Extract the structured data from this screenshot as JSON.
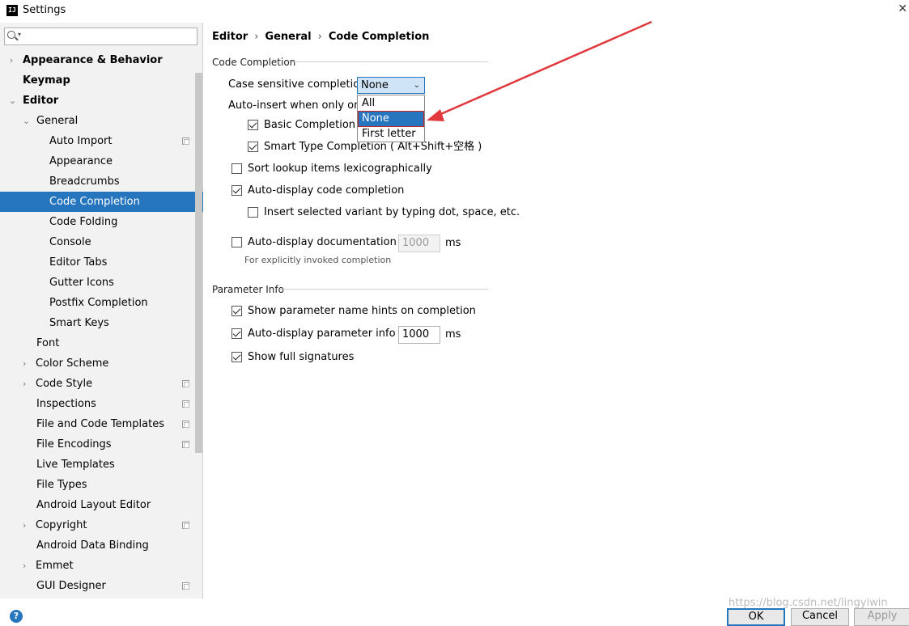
{
  "window": {
    "title": "Settings",
    "app_icon_text": "IJ"
  },
  "search": {
    "placeholder": ""
  },
  "sidebar": {
    "items": [
      {
        "label": "Appearance & Behavior"
      },
      {
        "label": "Keymap"
      },
      {
        "label": "Editor"
      },
      {
        "label": "General"
      },
      {
        "label": "Auto Import"
      },
      {
        "label": "Appearance"
      },
      {
        "label": "Breadcrumbs"
      },
      {
        "label": "Code Completion"
      },
      {
        "label": "Code Folding"
      },
      {
        "label": "Console"
      },
      {
        "label": "Editor Tabs"
      },
      {
        "label": "Gutter Icons"
      },
      {
        "label": "Postfix Completion"
      },
      {
        "label": "Smart Keys"
      },
      {
        "label": "Font"
      },
      {
        "label": "Color Scheme"
      },
      {
        "label": "Code Style"
      },
      {
        "label": "Inspections"
      },
      {
        "label": "File and Code Templates"
      },
      {
        "label": "File Encodings"
      },
      {
        "label": "Live Templates"
      },
      {
        "label": "File Types"
      },
      {
        "label": "Android Layout Editor"
      },
      {
        "label": "Copyright"
      },
      {
        "label": "Android Data Binding"
      },
      {
        "label": "Emmet"
      },
      {
        "label": "GUI Designer"
      }
    ]
  },
  "breadcrumb": [
    "Editor",
    "General",
    "Code Completion"
  ],
  "code_completion": {
    "title": "Code Completion",
    "case_sensitive_label": "Case sensitive completion:",
    "case_sensitive_value": "None",
    "case_sensitive_options": [
      "All",
      "None",
      "First letter"
    ],
    "auto_insert_label": "Auto-insert when only one c",
    "basic_completion_label": "Basic Completion (",
    "smart_type_label": "Smart Type Completion ( Alt+Shift+空格 )",
    "sort_lookup_label": "Sort lookup items lexicographically",
    "auto_display_label": "Auto-display code completion",
    "insert_selected_label": "Insert selected variant by typing dot, space, etc.",
    "auto_doc_label": "Auto-display documentation in",
    "auto_doc_value": "1000",
    "auto_doc_unit": "ms",
    "auto_doc_hint": "For explicitly invoked completion"
  },
  "parameter_info": {
    "title": "Parameter Info",
    "show_hints_label": "Show parameter name hints on completion",
    "auto_display_label": "Auto-display parameter info in",
    "auto_display_value": "1000",
    "auto_display_unit": "ms",
    "full_signatures_label": "Show full signatures"
  },
  "footer": {
    "help_label": "?",
    "ok_label": "OK",
    "cancel_label": "Cancel",
    "apply_label": "Apply",
    "watermark": "https://blog.csdn.net/lingyiwin"
  },
  "colors": {
    "accent": "#2675bf",
    "annotation_arrow": "#e0383d"
  }
}
